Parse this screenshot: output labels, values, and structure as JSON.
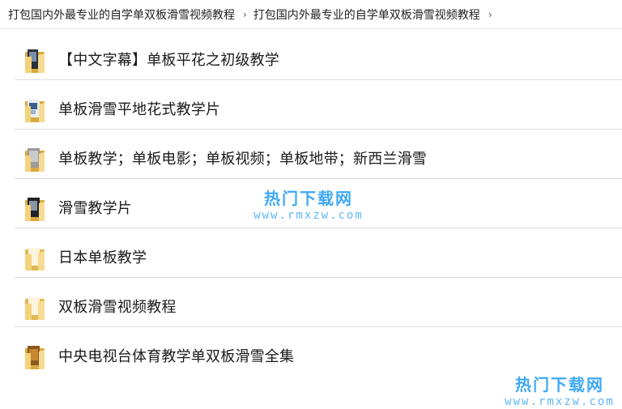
{
  "breadcrumb": {
    "items": [
      "打包国内外最专业的自学单双板滑雪视频教程",
      "打包国内外最专业的自学单双板滑雪视频教程"
    ],
    "separator": "›"
  },
  "folders": [
    {
      "name": "【中文字幕】单板平花之初级教学",
      "icon": "folder-with-video-preview-icon"
    },
    {
      "name": "单板滑雪平地花式教学片",
      "icon": "folder-with-video-preview-icon"
    },
    {
      "name": "单板教学；单板电影；单板视频；单板地带；新西兰滑雪",
      "icon": "folder-with-video-preview-icon"
    },
    {
      "name": "滑雪教学片",
      "icon": "folder-with-video-preview-icon"
    },
    {
      "name": "日本单板教学",
      "icon": "folder-icon"
    },
    {
      "name": "双板滑雪视频教程",
      "icon": "folder-icon"
    },
    {
      "name": "中央电视台体育教学单双板滑雪全集",
      "icon": "folder-with-image-preview-icon"
    }
  ],
  "watermark": {
    "title": "热门下载网",
    "url": "www.rmxzw.com"
  },
  "colors": {
    "folder_yellow": "#f3d27a",
    "folder_dark": "#d9a93f",
    "watermark": "#3fa9f5"
  }
}
